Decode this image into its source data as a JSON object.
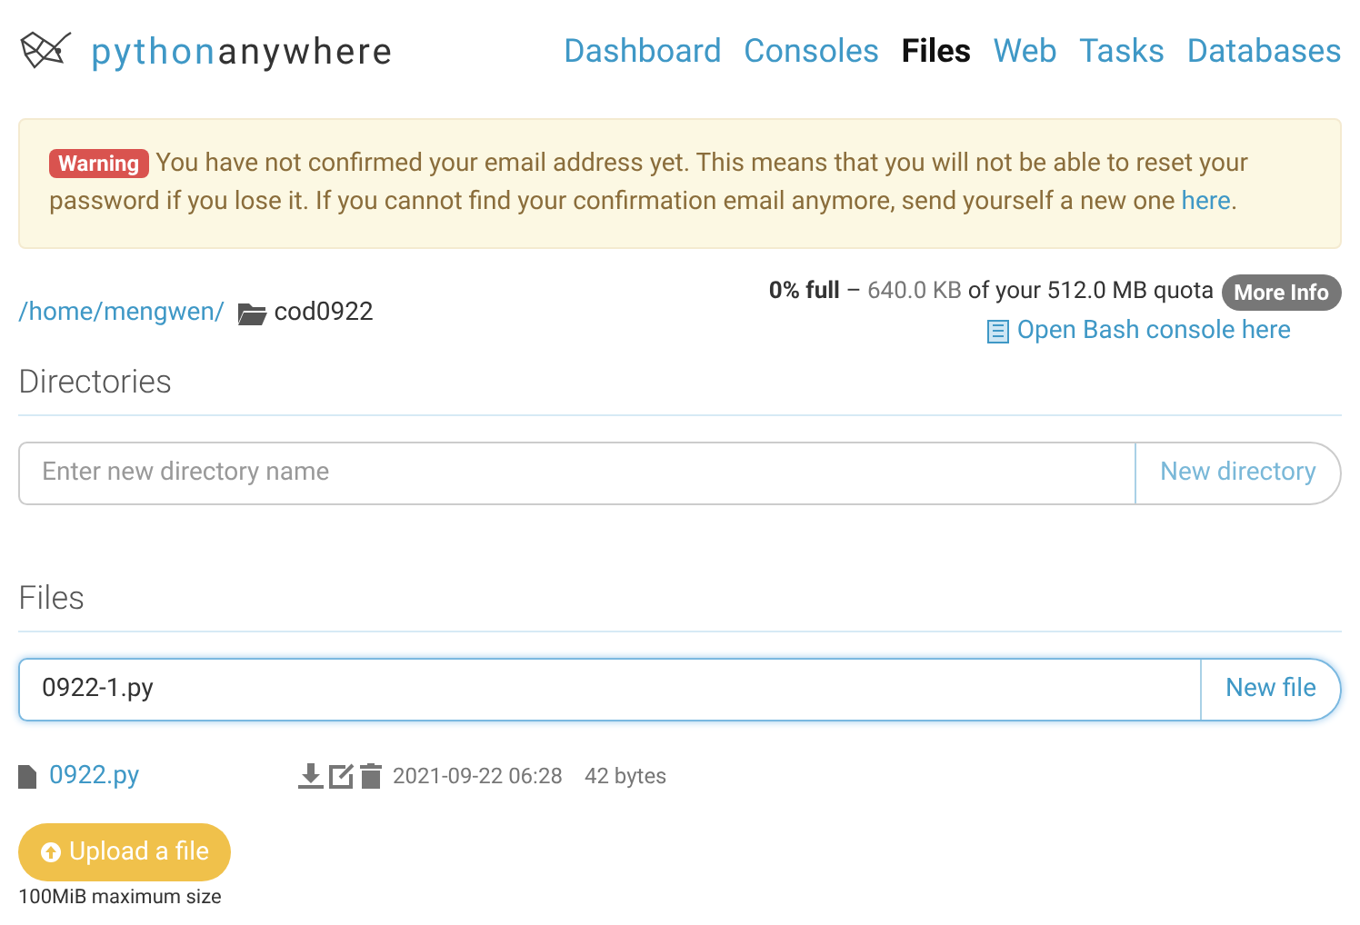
{
  "logo": {
    "part_1": "python",
    "part_2": "anywhere"
  },
  "nav": [
    {
      "label": "Dashboard",
      "selected": false
    },
    {
      "label": "Consoles",
      "selected": false
    },
    {
      "label": "Files",
      "selected": true
    },
    {
      "label": "Web",
      "selected": false
    },
    {
      "label": "Tasks",
      "selected": false
    },
    {
      "label": "Databases",
      "selected": false
    }
  ],
  "warning": {
    "badge": "Warning",
    "text": "You have not confirmed your email address yet. This means that you will not be able to reset your password if you lose it. If you cannot find your confirmation email anymore, send yourself a new one",
    "link": "here",
    "end": "."
  },
  "breadcrumb": {
    "links": [
      "/home/",
      "mengwen/"
    ],
    "current": "cod0922"
  },
  "quota": {
    "full": "0% full",
    "dash": "–",
    "used": "640.0 KB",
    "rest": "of your 512.0 MB quota",
    "more_info": "More Info",
    "bash_link": "Open Bash console here"
  },
  "directories": {
    "heading": "Directories",
    "placeholder": "Enter new directory name",
    "button": "New directory"
  },
  "files": {
    "heading": "Files",
    "value": "0922-1.py",
    "button": "New file",
    "rows": [
      {
        "name": "0922.py",
        "modified": "2021-09-22 06:28",
        "size": "42 bytes"
      }
    ]
  },
  "upload": {
    "button": "Upload a file",
    "note": "100MiB maximum size"
  }
}
